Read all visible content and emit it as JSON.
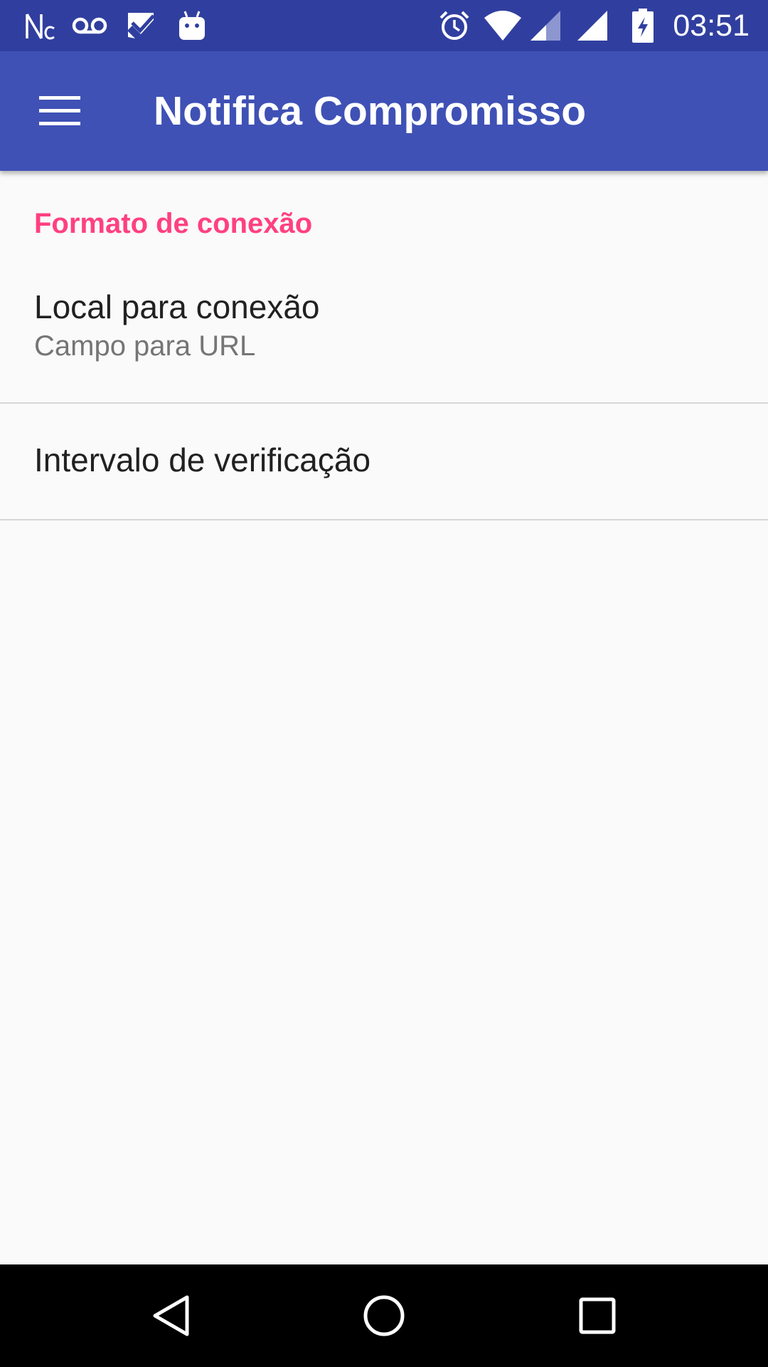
{
  "status_bar": {
    "time": "03:51",
    "left_icons": [
      "nc-icon",
      "voicemail-icon",
      "check-app-icon",
      "android-icon"
    ],
    "right_icons": [
      "alarm-icon",
      "wifi-icon",
      "signal-icon",
      "signal-icon",
      "battery-charging-icon"
    ]
  },
  "app_bar": {
    "title": "Notifica Compromisso",
    "nav_icon": "menu-icon",
    "background": "#3f51b5",
    "status_background": "#303f9f"
  },
  "preferences": {
    "category": {
      "title": "Formato de conexão",
      "color": "#ff4081"
    },
    "items": [
      {
        "title": "Local para conexão",
        "summary": "Campo para URL"
      },
      {
        "title": "Intervalo de verificação"
      }
    ]
  },
  "nav_bar": {
    "buttons": [
      "back-icon",
      "home-icon",
      "recents-icon"
    ]
  }
}
